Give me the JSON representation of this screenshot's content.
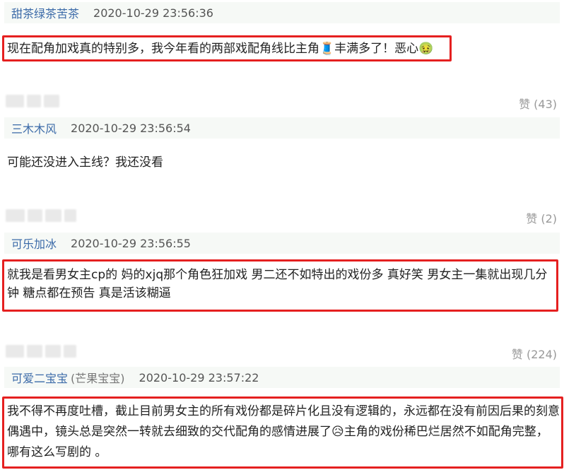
{
  "comments": [
    {
      "user": "甜茶绿茶苦茶",
      "time": "2020-10-29 23:56:36",
      "text": "现在配角加戏真的特别多，我今年看的两部戏配角线比主角",
      "emoji1": "🧵",
      "text_after": "丰满多了！恶心",
      "emoji2": "🤢",
      "likes": "赞 (43)"
    },
    {
      "user": "三木木风",
      "time": "2020-10-29 23:56:54",
      "text": "可能还没进入主线？我还没看",
      "likes": "赞 (2)"
    },
    {
      "user": "可乐加冰",
      "time": "2020-10-29 23:56:55",
      "text": "就我是看男女主cp的 妈的xjq那个角色狂加戏 男二还不如特出的戏份多 真好笑 男女主一集就出现几分钟 糖点都在预告 真是活该糊逼",
      "likes": "赞 (224)"
    },
    {
      "user": "可爱二宝宝",
      "alias": "(芒果宝宝)",
      "time": "2020-10-29 23:57:22",
      "text": "我不得不再度吐槽，截止目前男女主的所有戏份都是碎片化且没有逻辑的，永远都在没有前因后果的刻意偶遇中，镜头总是突然一转就去细致的交代配角的感情进展了",
      "emoji": "😥",
      "text_after": "主角的戏份稀巴烂居然不如配角完整，哪有这么写剧的 。"
    }
  ],
  "colors": {
    "username": "#3b6aa8",
    "highlight": "#e52020",
    "meta_bg": "#f6f9f6",
    "likes": "#999999"
  }
}
